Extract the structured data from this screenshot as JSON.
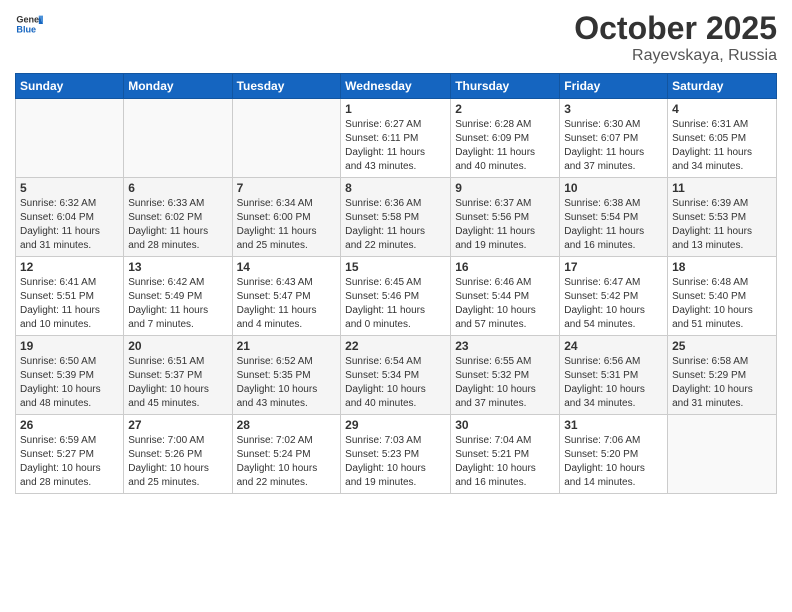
{
  "header": {
    "logo_general": "General",
    "logo_blue": "Blue",
    "month": "October 2025",
    "location": "Rayevskaya, Russia"
  },
  "weekdays": [
    "Sunday",
    "Monday",
    "Tuesday",
    "Wednesday",
    "Thursday",
    "Friday",
    "Saturday"
  ],
  "weeks": [
    [
      {
        "day": "",
        "info": ""
      },
      {
        "day": "",
        "info": ""
      },
      {
        "day": "",
        "info": ""
      },
      {
        "day": "1",
        "info": "Sunrise: 6:27 AM\nSunset: 6:11 PM\nDaylight: 11 hours\nand 43 minutes."
      },
      {
        "day": "2",
        "info": "Sunrise: 6:28 AM\nSunset: 6:09 PM\nDaylight: 11 hours\nand 40 minutes."
      },
      {
        "day": "3",
        "info": "Sunrise: 6:30 AM\nSunset: 6:07 PM\nDaylight: 11 hours\nand 37 minutes."
      },
      {
        "day": "4",
        "info": "Sunrise: 6:31 AM\nSunset: 6:05 PM\nDaylight: 11 hours\nand 34 minutes."
      }
    ],
    [
      {
        "day": "5",
        "info": "Sunrise: 6:32 AM\nSunset: 6:04 PM\nDaylight: 11 hours\nand 31 minutes."
      },
      {
        "day": "6",
        "info": "Sunrise: 6:33 AM\nSunset: 6:02 PM\nDaylight: 11 hours\nand 28 minutes."
      },
      {
        "day": "7",
        "info": "Sunrise: 6:34 AM\nSunset: 6:00 PM\nDaylight: 11 hours\nand 25 minutes."
      },
      {
        "day": "8",
        "info": "Sunrise: 6:36 AM\nSunset: 5:58 PM\nDaylight: 11 hours\nand 22 minutes."
      },
      {
        "day": "9",
        "info": "Sunrise: 6:37 AM\nSunset: 5:56 PM\nDaylight: 11 hours\nand 19 minutes."
      },
      {
        "day": "10",
        "info": "Sunrise: 6:38 AM\nSunset: 5:54 PM\nDaylight: 11 hours\nand 16 minutes."
      },
      {
        "day": "11",
        "info": "Sunrise: 6:39 AM\nSunset: 5:53 PM\nDaylight: 11 hours\nand 13 minutes."
      }
    ],
    [
      {
        "day": "12",
        "info": "Sunrise: 6:41 AM\nSunset: 5:51 PM\nDaylight: 11 hours\nand 10 minutes."
      },
      {
        "day": "13",
        "info": "Sunrise: 6:42 AM\nSunset: 5:49 PM\nDaylight: 11 hours\nand 7 minutes."
      },
      {
        "day": "14",
        "info": "Sunrise: 6:43 AM\nSunset: 5:47 PM\nDaylight: 11 hours\nand 4 minutes."
      },
      {
        "day": "15",
        "info": "Sunrise: 6:45 AM\nSunset: 5:46 PM\nDaylight: 11 hours\nand 0 minutes."
      },
      {
        "day": "16",
        "info": "Sunrise: 6:46 AM\nSunset: 5:44 PM\nDaylight: 10 hours\nand 57 minutes."
      },
      {
        "day": "17",
        "info": "Sunrise: 6:47 AM\nSunset: 5:42 PM\nDaylight: 10 hours\nand 54 minutes."
      },
      {
        "day": "18",
        "info": "Sunrise: 6:48 AM\nSunset: 5:40 PM\nDaylight: 10 hours\nand 51 minutes."
      }
    ],
    [
      {
        "day": "19",
        "info": "Sunrise: 6:50 AM\nSunset: 5:39 PM\nDaylight: 10 hours\nand 48 minutes."
      },
      {
        "day": "20",
        "info": "Sunrise: 6:51 AM\nSunset: 5:37 PM\nDaylight: 10 hours\nand 45 minutes."
      },
      {
        "day": "21",
        "info": "Sunrise: 6:52 AM\nSunset: 5:35 PM\nDaylight: 10 hours\nand 43 minutes."
      },
      {
        "day": "22",
        "info": "Sunrise: 6:54 AM\nSunset: 5:34 PM\nDaylight: 10 hours\nand 40 minutes."
      },
      {
        "day": "23",
        "info": "Sunrise: 6:55 AM\nSunset: 5:32 PM\nDaylight: 10 hours\nand 37 minutes."
      },
      {
        "day": "24",
        "info": "Sunrise: 6:56 AM\nSunset: 5:31 PM\nDaylight: 10 hours\nand 34 minutes."
      },
      {
        "day": "25",
        "info": "Sunrise: 6:58 AM\nSunset: 5:29 PM\nDaylight: 10 hours\nand 31 minutes."
      }
    ],
    [
      {
        "day": "26",
        "info": "Sunrise: 6:59 AM\nSunset: 5:27 PM\nDaylight: 10 hours\nand 28 minutes."
      },
      {
        "day": "27",
        "info": "Sunrise: 7:00 AM\nSunset: 5:26 PM\nDaylight: 10 hours\nand 25 minutes."
      },
      {
        "day": "28",
        "info": "Sunrise: 7:02 AM\nSunset: 5:24 PM\nDaylight: 10 hours\nand 22 minutes."
      },
      {
        "day": "29",
        "info": "Sunrise: 7:03 AM\nSunset: 5:23 PM\nDaylight: 10 hours\nand 19 minutes."
      },
      {
        "day": "30",
        "info": "Sunrise: 7:04 AM\nSunset: 5:21 PM\nDaylight: 10 hours\nand 16 minutes."
      },
      {
        "day": "31",
        "info": "Sunrise: 7:06 AM\nSunset: 5:20 PM\nDaylight: 10 hours\nand 14 minutes."
      },
      {
        "day": "",
        "info": ""
      }
    ]
  ]
}
